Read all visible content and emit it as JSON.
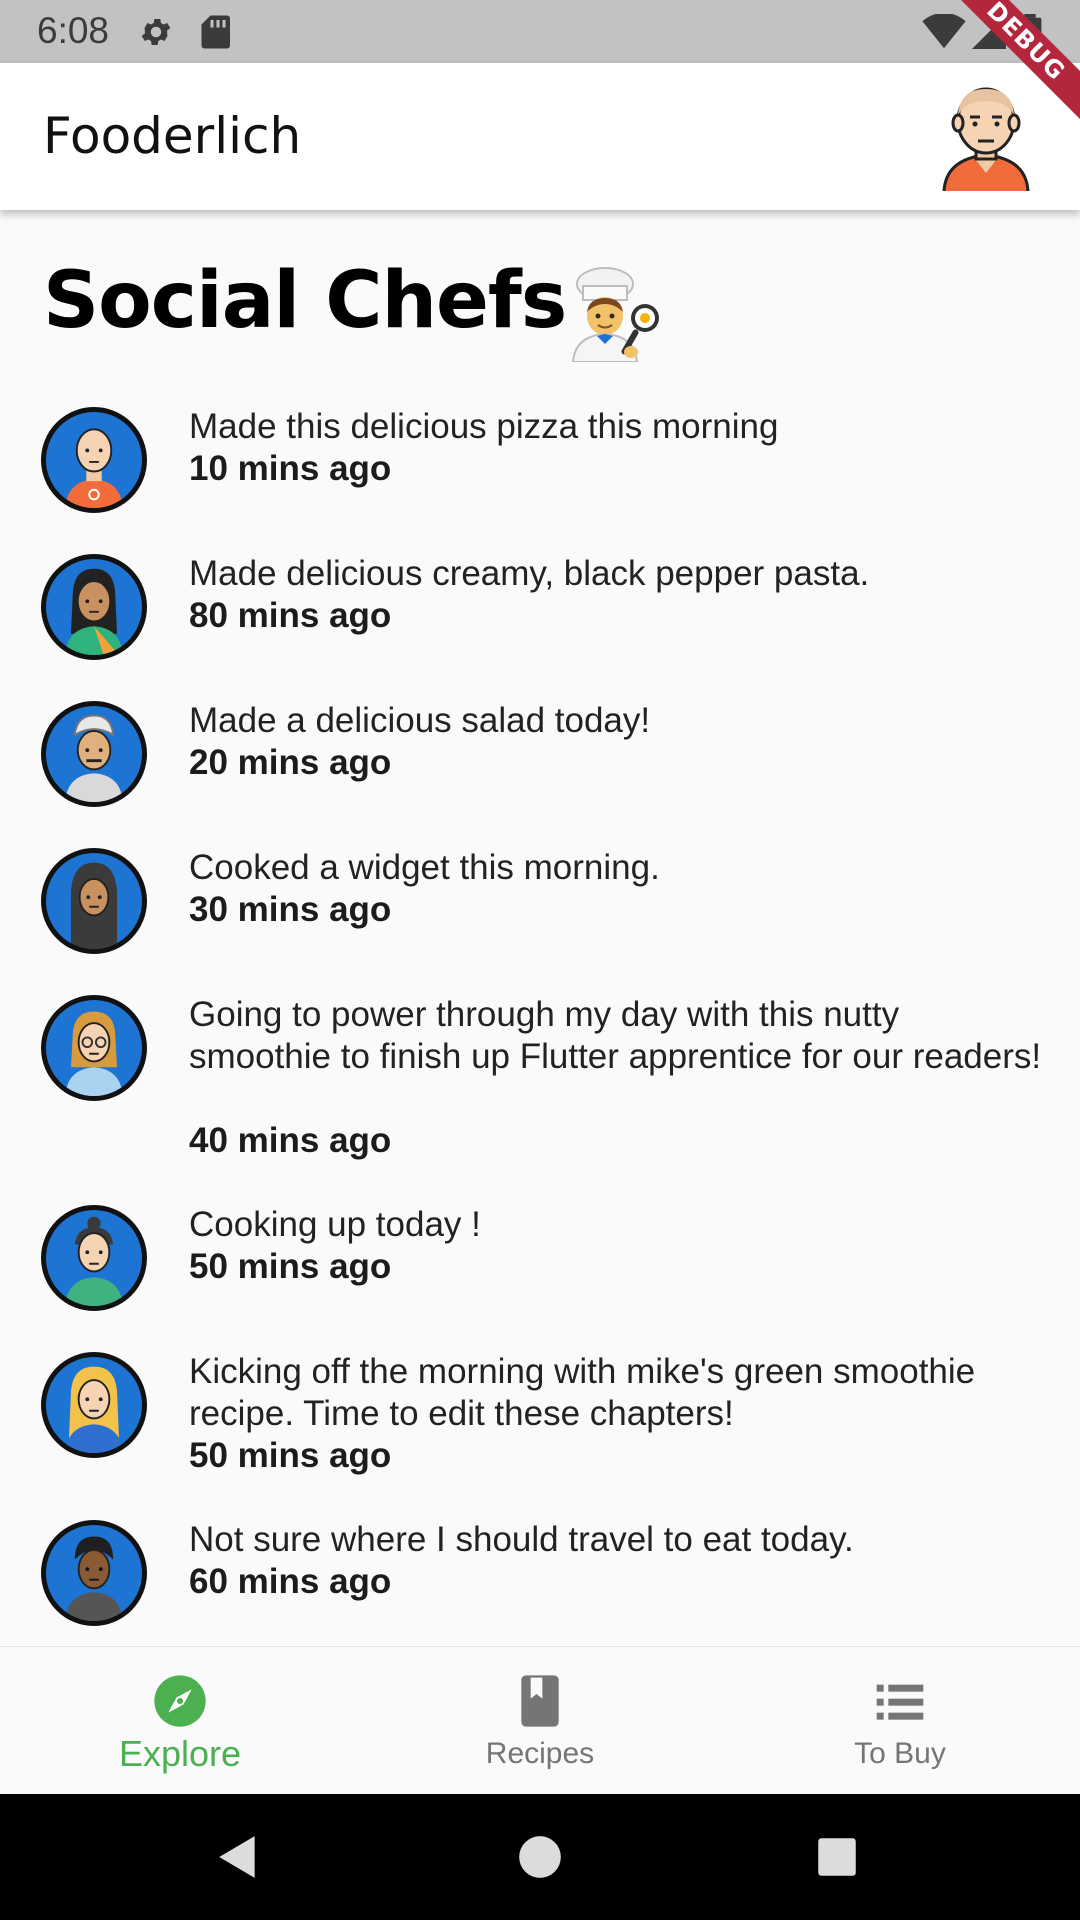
{
  "status_bar": {
    "time": "6:08"
  },
  "debug_banner": {
    "label": "DEBUG"
  },
  "app_bar": {
    "title": "Fooderlich"
  },
  "page": {
    "title": "Social Chefs"
  },
  "feed": [
    {
      "message": "Made this delicious pizza this morning",
      "time": "10 mins ago"
    },
    {
      "message": "Made delicious creamy, black pepper pasta.",
      "time": "80 mins ago"
    },
    {
      "message": "Made a delicious salad today!",
      "time": "20 mins ago"
    },
    {
      "message": "Cooked a widget this morning.",
      "time": "30 mins ago"
    },
    {
      "message": "Going to power through my day with this nutty smoothie to finish up Flutter apprentice for our readers!",
      "time": "40 mins ago"
    },
    {
      "message": "Cooking up today !",
      "time": "50 mins ago"
    },
    {
      "message": "Kicking off the morning with mike's green smoothie recipe. Time to edit these chapters!",
      "time": "50 mins ago"
    },
    {
      "message": "Not sure where I should travel to eat today.",
      "time": "60 mins ago"
    }
  ],
  "bottom_nav": {
    "items": [
      {
        "label": "Explore",
        "icon": "compass-icon",
        "active": true
      },
      {
        "label": "Recipes",
        "icon": "book-icon",
        "active": false
      },
      {
        "label": "To Buy",
        "icon": "list-icon",
        "active": false
      }
    ]
  },
  "colors": {
    "accent": "#4caf50",
    "avatar_bg": "#1e74d2",
    "debug": "#b3263c"
  }
}
